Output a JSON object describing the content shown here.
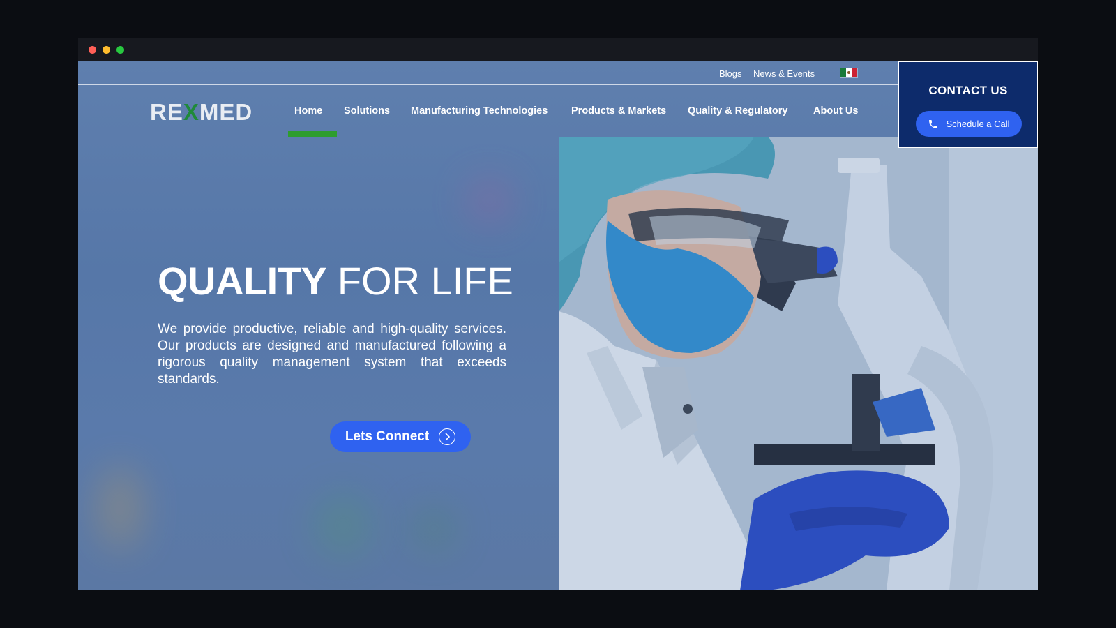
{
  "utility": {
    "blogs": "Blogs",
    "news_events": "News & Events",
    "flag_icon": "mexico-flag-icon"
  },
  "logo": {
    "part1": "RE",
    "part2": "X",
    "part3": "MED"
  },
  "nav": {
    "items": [
      {
        "label": "Home",
        "active": true
      },
      {
        "label": "Solutions"
      },
      {
        "label": "Manufacturing Technologies"
      },
      {
        "label": "Products & Markets"
      },
      {
        "label": "Quality & Regulatory"
      },
      {
        "label": "About Us"
      }
    ]
  },
  "contact": {
    "title": "CONTACT US",
    "schedule_label": "Schedule a Call",
    "schedule_icon": "phone-icon"
  },
  "hero": {
    "title_strong": "QUALITY",
    "title_light": "FOR LIFE",
    "body": "We provide productive, reliable and high-quality services. Our products are designed and manufactured following a rigorous quality management system that exceeds standards.",
    "cta_label": "Lets Connect",
    "cta_icon": "chevron-right-circle-icon"
  },
  "colors": {
    "accent": "#2f62f0",
    "nav_active": "#2e9d2e",
    "contact_bg": "#0d2b6b",
    "hero_bg": "#5a7aab"
  }
}
